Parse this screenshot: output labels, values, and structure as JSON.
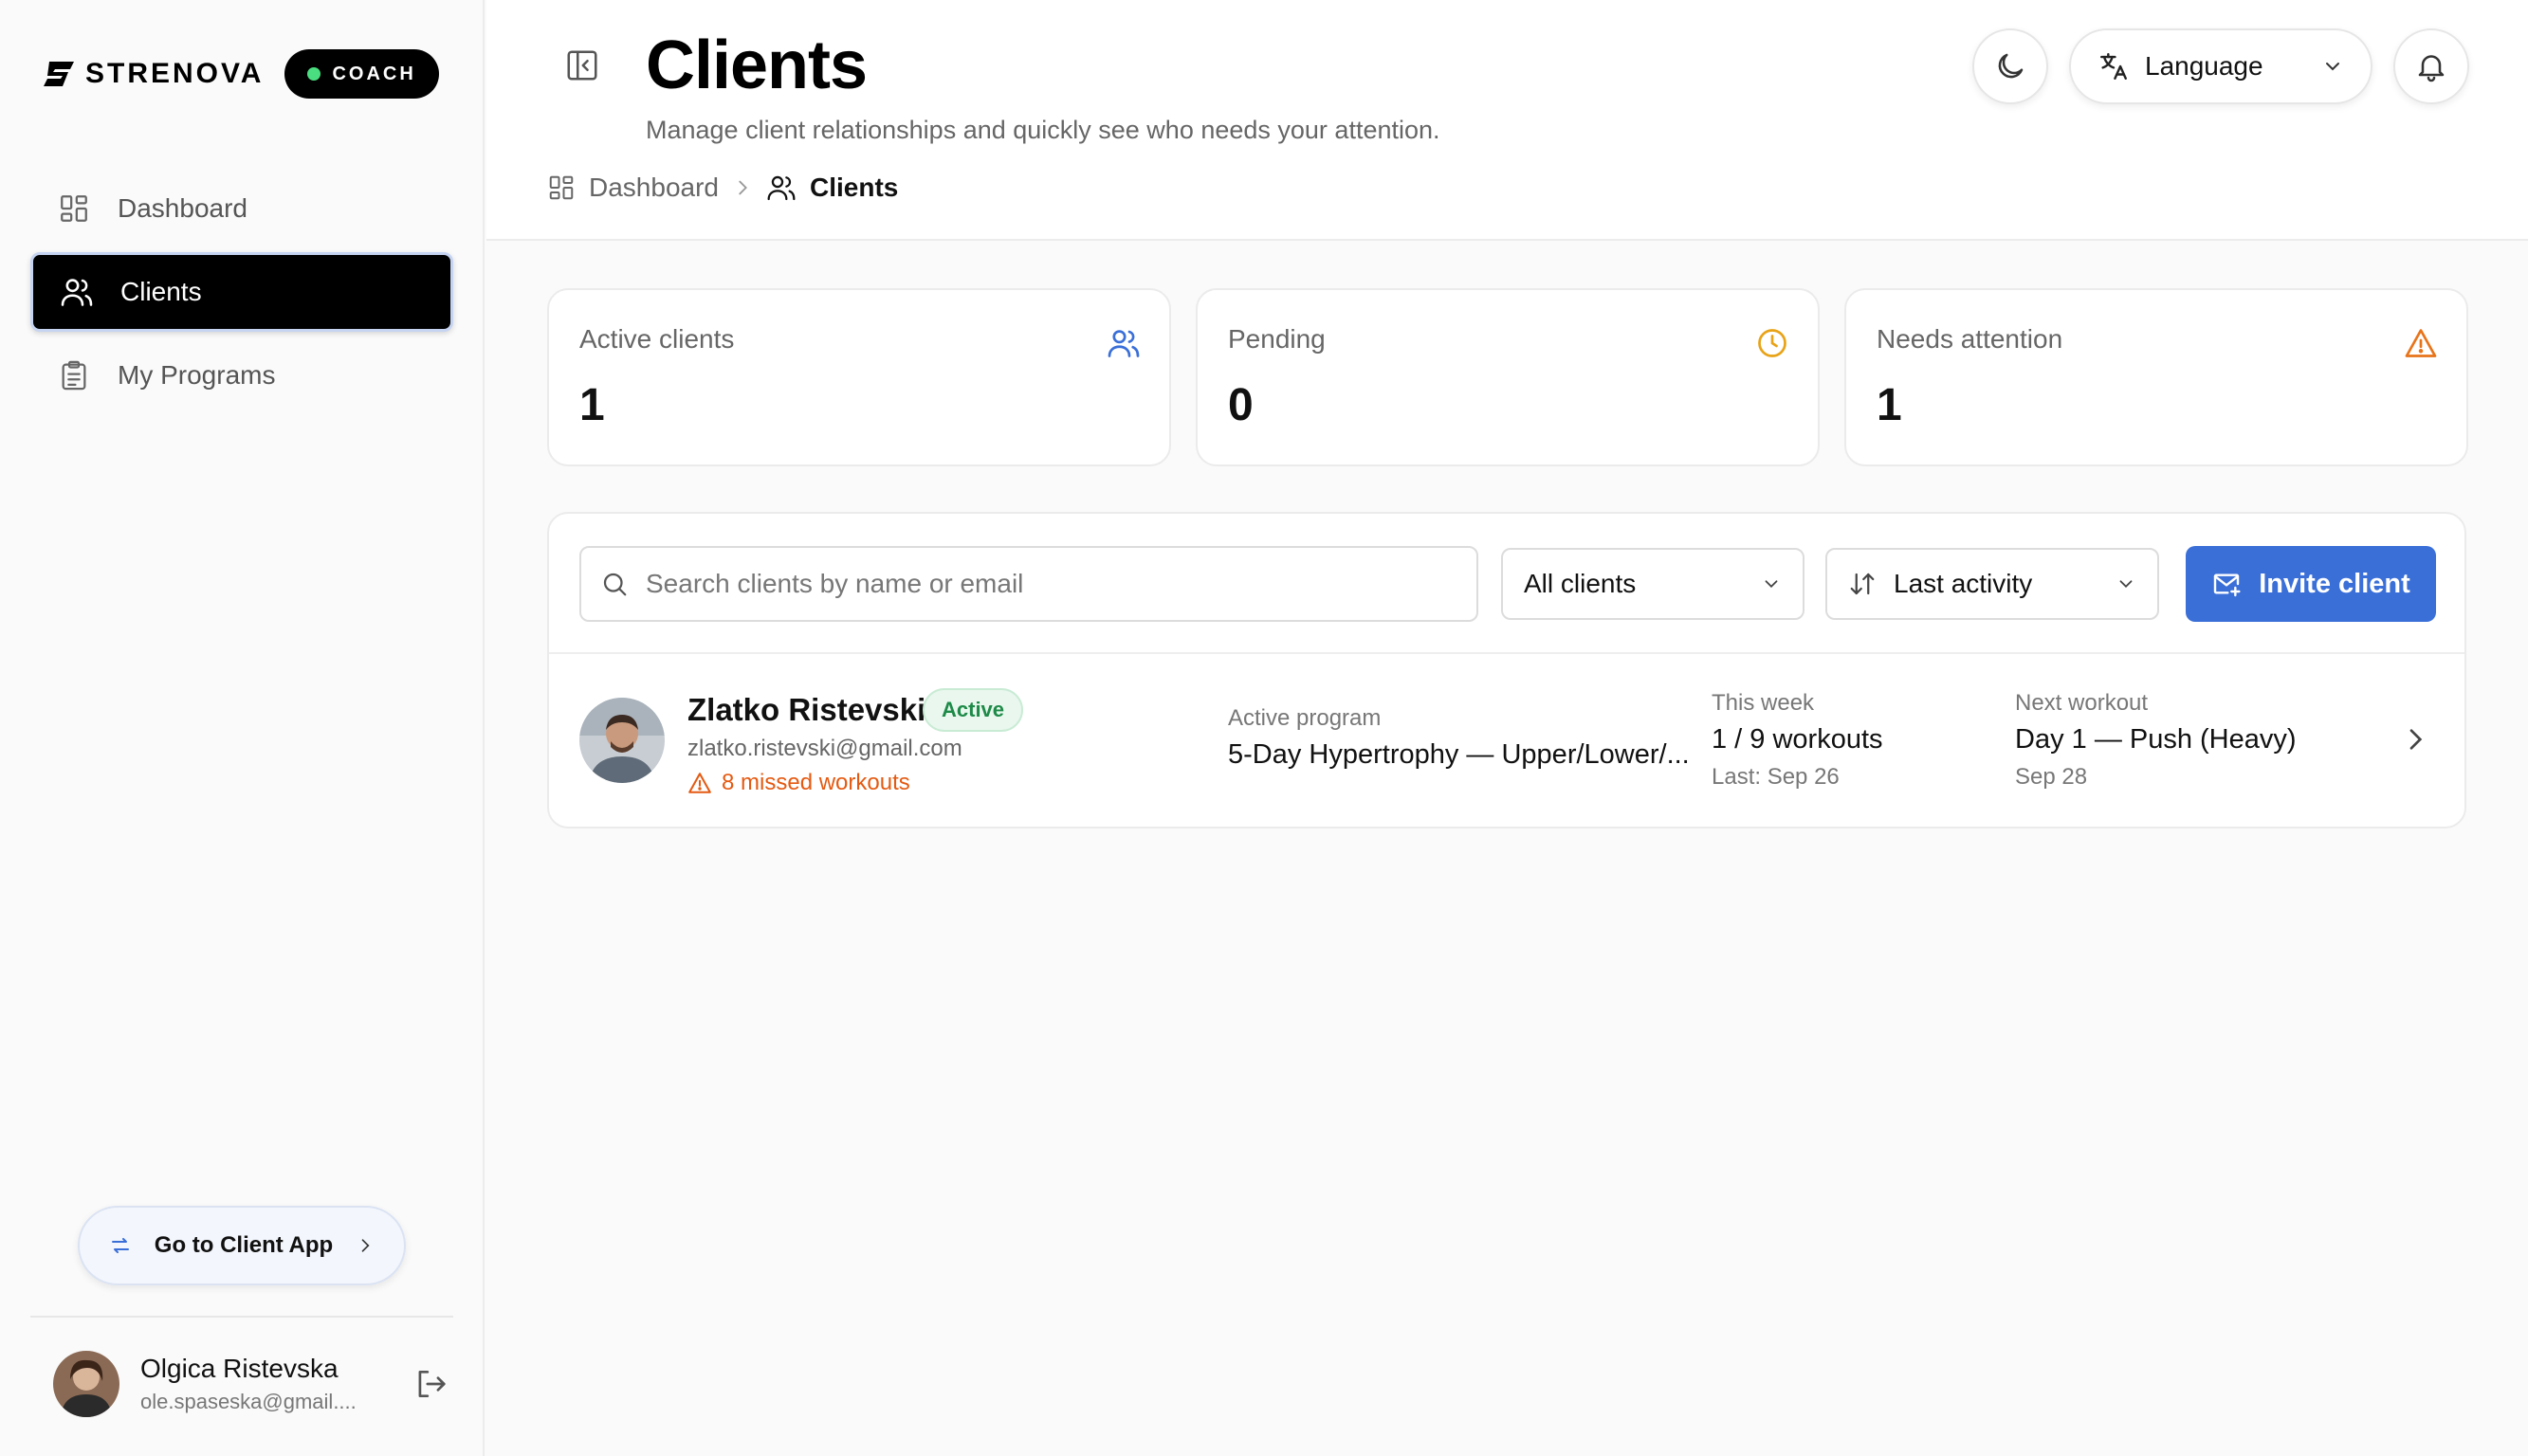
{
  "brand": {
    "name": "STRENOVA",
    "role_badge": "COACH"
  },
  "sidebar": {
    "items": [
      {
        "label": "Dashboard",
        "icon": "dashboard-grid-icon",
        "active": false
      },
      {
        "label": "Clients",
        "icon": "users-icon",
        "active": true
      },
      {
        "label": "My Programs",
        "icon": "clipboard-icon",
        "active": false
      }
    ],
    "client_app_button": "Go to Client App",
    "user": {
      "name": "Olgica Ristevska",
      "email": "ole.spaseska@gmail...."
    }
  },
  "header": {
    "title": "Clients",
    "subtitle": "Manage client relationships and quickly see who needs your attention.",
    "breadcrumb": [
      "Dashboard",
      "Clients"
    ],
    "language_label": "Language"
  },
  "stats": [
    {
      "label": "Active clients",
      "value": "1",
      "icon": "users-icon",
      "color": "#3a6fd8"
    },
    {
      "label": "Pending",
      "value": "0",
      "icon": "clock-icon",
      "color": "#e8a317"
    },
    {
      "label": "Needs attention",
      "value": "1",
      "icon": "warning-icon",
      "color": "#e8741a"
    }
  ],
  "toolbar": {
    "search_placeholder": "Search clients by name or email",
    "filter_selected": "All clients",
    "sort_selected": "Last activity",
    "invite_label": "Invite client"
  },
  "clients": [
    {
      "name": "Zlatko Ristevski",
      "status": "Active",
      "email": "zlatko.ristevski@gmail.com",
      "warning": "8 missed workouts",
      "program_label": "Active program",
      "program_value": "5-Day Hypertrophy — Upper/Lower/...",
      "week_label": "This week",
      "week_value": "1 / 9 workouts",
      "week_sub": "Last: Sep 26",
      "next_label": "Next workout",
      "next_value": "Day 1 — Push (Heavy)",
      "next_sub": "Sep 28"
    }
  ],
  "colors": {
    "accent": "#3a6fd8",
    "active_nav": "#000000",
    "warning": "#e45a12",
    "success": "#1e8a48"
  }
}
